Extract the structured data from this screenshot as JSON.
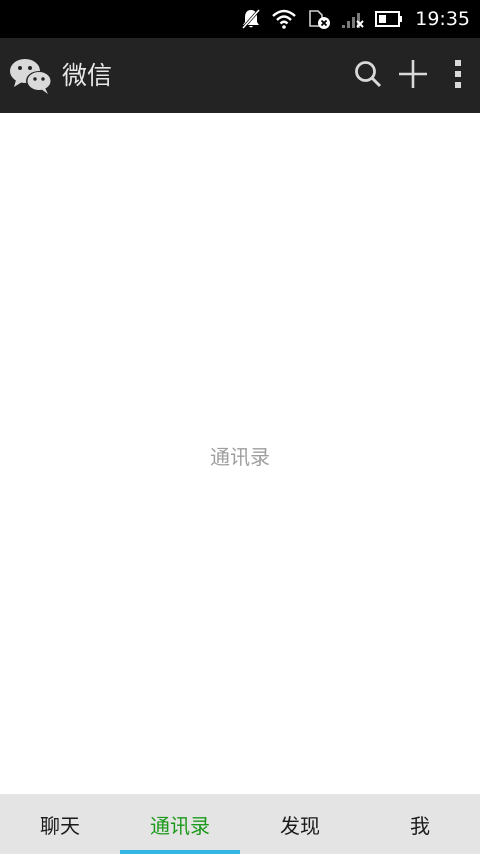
{
  "status_bar": {
    "time": "19:35",
    "icons": [
      "notifications-muted-icon",
      "wifi-icon",
      "sim-error-icon",
      "signal-no-service-icon",
      "battery-icon"
    ]
  },
  "action_bar": {
    "logo_icon": "wechat-logo-icon",
    "title": "微信",
    "actions": [
      "search-icon",
      "plus-icon",
      "more-vert-icon"
    ]
  },
  "content": {
    "placeholder": "通讯录"
  },
  "tabs": [
    {
      "label": "聊天",
      "active": false
    },
    {
      "label": "通讯录",
      "active": true
    },
    {
      "label": "发现",
      "active": false
    },
    {
      "label": "我",
      "active": false
    }
  ],
  "colors": {
    "status_bar_bg": "#000000",
    "action_bar_bg": "#232323",
    "tab_bar_bg": "#e4e4e4",
    "active_tab_text": "#1b9a1b",
    "active_tab_indicator": "#33b5e5",
    "placeholder_text": "#9e9e9e"
  }
}
